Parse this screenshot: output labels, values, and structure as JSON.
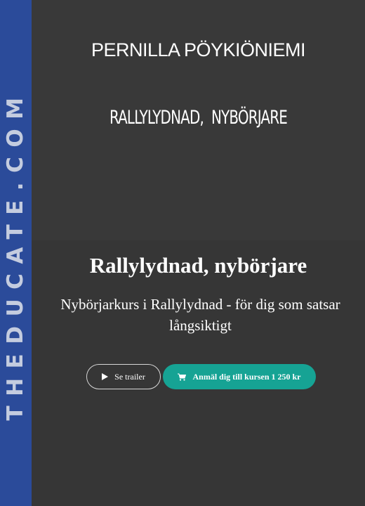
{
  "watermark": {
    "text": "THEDUCATE.COM"
  },
  "header": {
    "author": "PERNILLA PÖYKIÖNIEMI",
    "course_caps": "RALLYLYDNAD,  NYBÖRJARE"
  },
  "hero": {
    "title": "Rallylydnad, nybörjare",
    "subtitle": "Nybörjarkurs i Rallylydnad - för dig som satsar långsiktigt",
    "trailer_label": "Se trailer",
    "enroll_label": "Anmäl dig till kursen 1 250 kr"
  },
  "colors": {
    "side_strip": "#2b4b9a",
    "background": "#393939",
    "accent": "#16a394"
  },
  "icons": [
    "play-icon",
    "cart-icon"
  ]
}
